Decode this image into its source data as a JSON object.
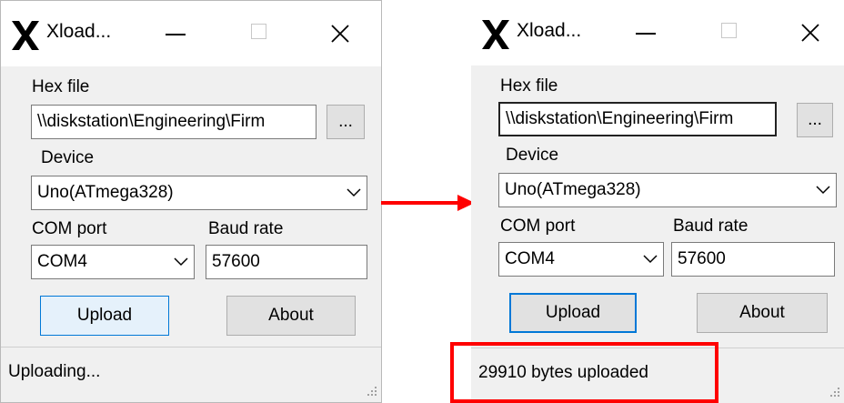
{
  "windows": [
    {
      "title": "Xload...",
      "hex_label": "Hex file",
      "hex_value": "\\\\diskstation\\Engineering\\Firm",
      "browse_label": "...",
      "device_label": "Device",
      "device_value": "Uno(ATmega328)",
      "com_label": "COM port",
      "com_value": "COM4",
      "baud_label": "Baud rate",
      "baud_value": "57600",
      "upload_label": "Upload",
      "about_label": "About",
      "status": "Uploading..."
    },
    {
      "title": "Xload...",
      "hex_label": "Hex file",
      "hex_value": "\\\\diskstation\\Engineering\\Firm",
      "browse_label": "...",
      "device_label": "Device",
      "device_value": "Uno(ATmega328)",
      "com_label": "COM port",
      "com_value": "COM4",
      "baud_label": "Baud rate",
      "baud_value": "57600",
      "upload_label": "Upload",
      "about_label": "About",
      "status": "29910 bytes uploaded"
    }
  ],
  "colors": {
    "annotation": "#ff0000",
    "focus_blue": "#0078d7",
    "window_bg": "#f0f0f0"
  },
  "icons": [
    "x-logo-icon",
    "minimize-icon",
    "maximize-icon",
    "close-icon",
    "chevron-down-icon",
    "resize-grip-icon",
    "arrow-right-icon"
  ]
}
